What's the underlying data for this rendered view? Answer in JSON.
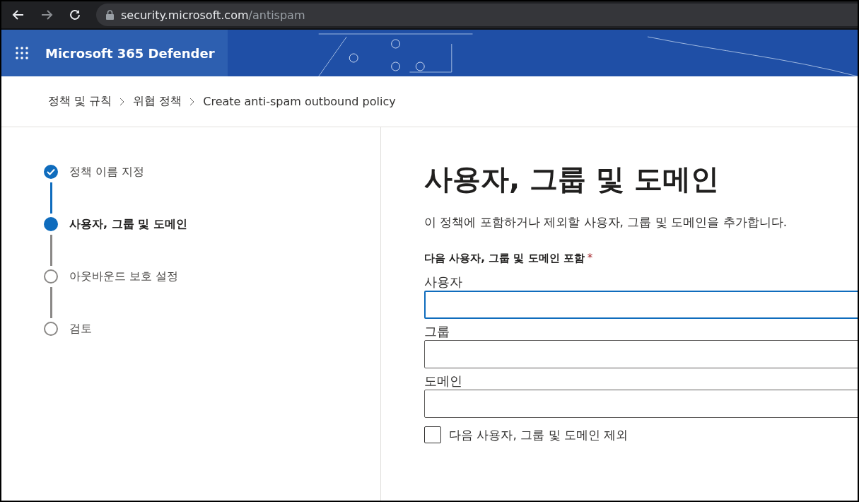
{
  "browser": {
    "url_host": "security.microsoft.com",
    "url_path": "/antispam"
  },
  "header": {
    "title": "Microsoft 365 Defender"
  },
  "breadcrumb": [
    "정책 및 규칙",
    "위협 정책",
    "Create anti-spam outbound policy"
  ],
  "steps": [
    {
      "label": "정책 이름 지정",
      "completed": true,
      "selected": false
    },
    {
      "label": "사용자, 그룹 및 도메인",
      "completed": false,
      "selected": true
    },
    {
      "label": "아웃바운드 보호 설정",
      "completed": false,
      "selected": false
    },
    {
      "label": "검토",
      "completed": false,
      "selected": false
    }
  ],
  "main": {
    "title": "사용자, 그룹 및 도메인",
    "description": "이 정책에 포함하거나 제외할 사용자, 그룹 및 도메인을 추가합니다.",
    "section_label": "다음 사용자, 그룹 및 도메인 포함",
    "required_mark": "*",
    "fields": [
      {
        "label": "사용자",
        "focused": true
      },
      {
        "label": "그룹",
        "focused": false
      },
      {
        "label": "도메인",
        "focused": false
      }
    ],
    "exclude": {
      "label": "다음 사용자, 그룹 및 도메인 제외",
      "checked": false
    }
  }
}
